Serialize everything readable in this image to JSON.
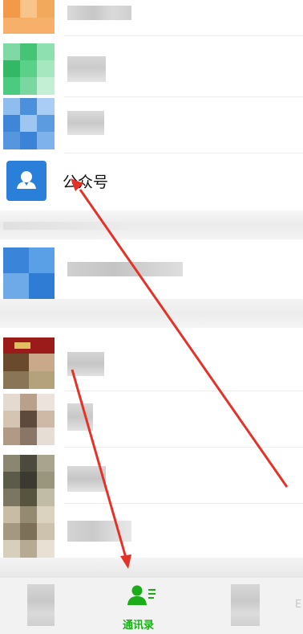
{
  "contacts": {
    "official_accounts_label": "公众号"
  },
  "tabbar": {
    "contacts_label": "通讯录",
    "right_label": "E"
  },
  "colors": {
    "accent_green": "#1aad19",
    "arrow_red": "#e53228",
    "official_icon_blue": "#2a7fd8"
  },
  "icons": [
    "person-icon",
    "contacts-icon"
  ]
}
